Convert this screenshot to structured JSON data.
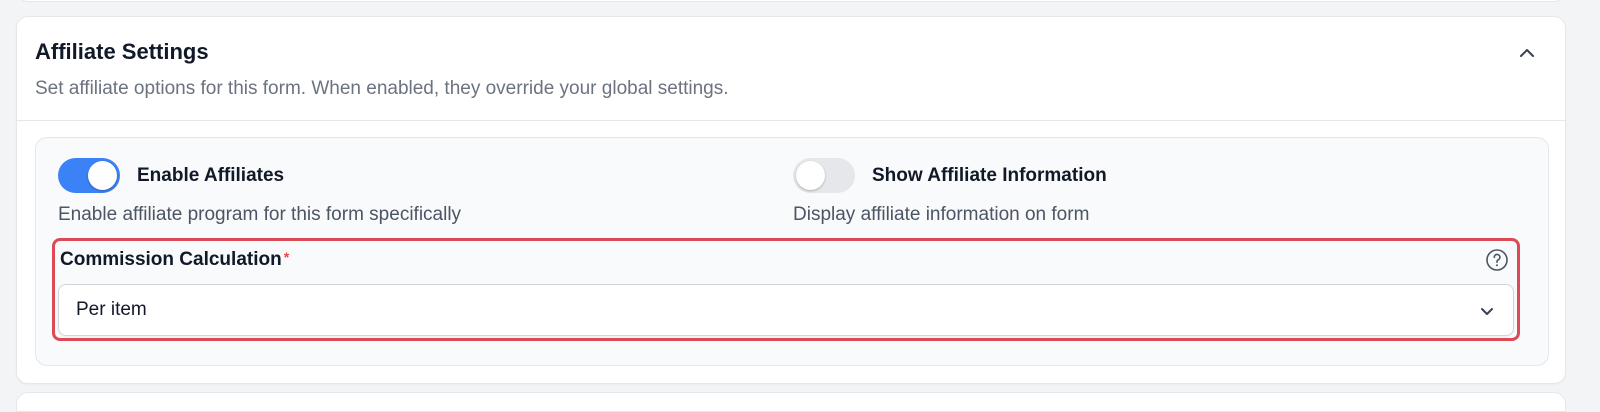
{
  "section": {
    "title": "Affiliate Settings",
    "description": "Set affiliate options for this form. When enabled, they override your global settings.",
    "collapse_icon": "chevron-up-icon"
  },
  "enable_affiliates": {
    "label": "Enable Affiliates",
    "help": "Enable affiliate program for this form specifically",
    "enabled": true
  },
  "show_affiliate_info": {
    "label": "Show Affiliate Information",
    "help": "Display affiliate information on form",
    "enabled": false
  },
  "commission": {
    "label": "Commission Calculation",
    "required_mark": "*",
    "help_icon": "question-circle-icon",
    "selected": "Per item",
    "dropdown_icon": "chevron-down-icon"
  },
  "colors": {
    "toggle_on": "#3b82f6",
    "toggle_off": "#e5e7eb",
    "highlight_border": "#dc4a56",
    "required": "#ef4444"
  }
}
